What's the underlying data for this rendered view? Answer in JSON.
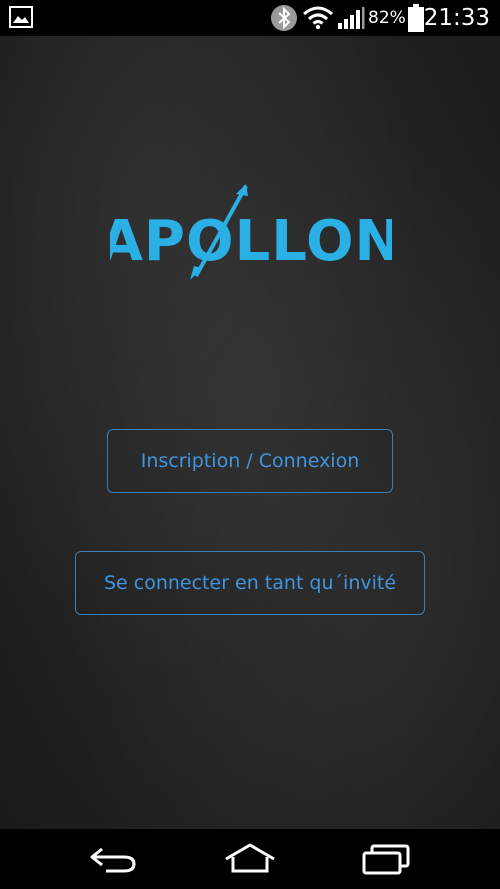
{
  "status_bar": {
    "battery_percent": "82%",
    "time": "21:33",
    "icons": [
      "gallery-icon",
      "bluetooth-icon",
      "wifi-icon",
      "signal-icon",
      "battery-icon"
    ]
  },
  "logo": {
    "text": "APOLLON",
    "color": "#2bb0e6"
  },
  "buttons": {
    "login_label": "Inscription / Connexion",
    "guest_label": "Se connecter en tant qu´invité"
  },
  "nav_bar": {
    "icons": [
      "back-icon",
      "home-icon",
      "recents-icon"
    ]
  },
  "colors": {
    "accent": "#3f95e0",
    "border": "#3b7fb8",
    "background": "#222222"
  }
}
